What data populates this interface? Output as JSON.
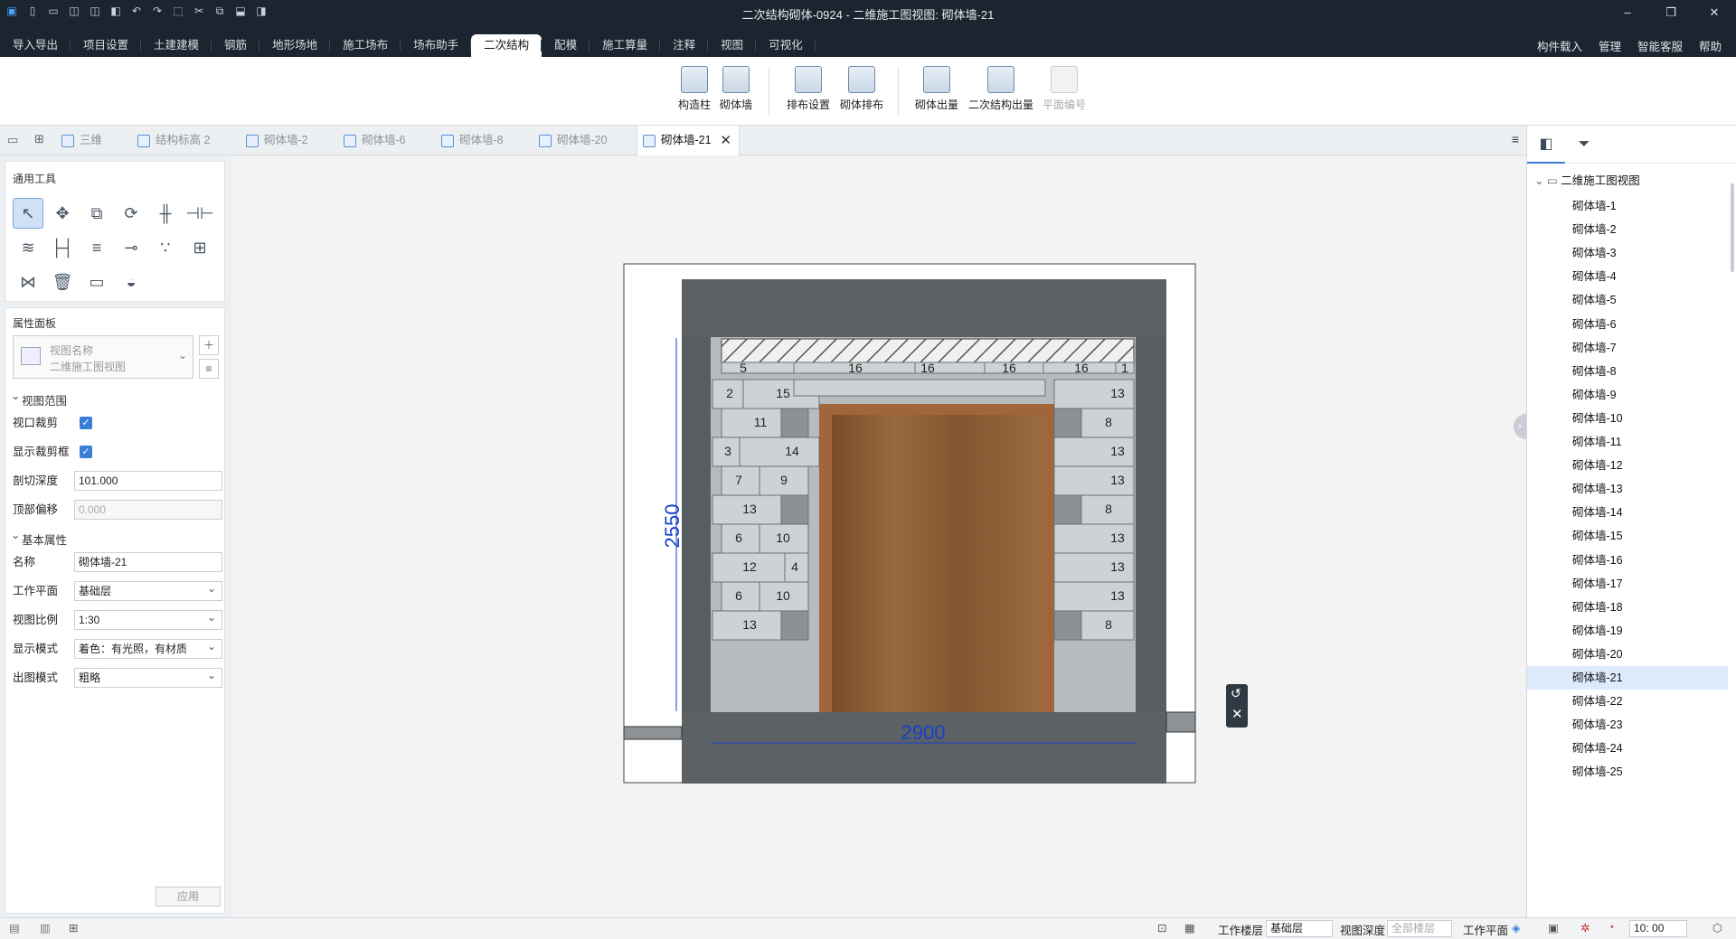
{
  "title": "二次结构砌体-0924 - 二维施工图视图: 砌体墙-21",
  "quick_access_icons": [
    "logo-icon",
    "new-icon",
    "open-icon",
    "save-icon",
    "save-as-icon",
    "export-icon",
    "undo-icon",
    "redo-icon",
    "select-icon",
    "cut-icon",
    "copy-icon",
    "paste-icon",
    "view-icon"
  ],
  "window": {
    "minimize": "–",
    "restore": "❐",
    "close": "✕"
  },
  "menu": {
    "tabs": [
      "导入导出",
      "项目设置",
      "土建建模",
      "钢筋",
      "地形场地",
      "施工场布",
      "场布助手",
      "二次结构",
      "配模",
      "施工算量",
      "注释",
      "视图",
      "可视化"
    ],
    "active": "二次结构",
    "right": [
      "构件载入",
      "管理",
      "智能客服",
      "帮助"
    ]
  },
  "ribbon": {
    "buttons": [
      "构造柱",
      "砌体墙",
      "排布设置",
      "砌体排布",
      "砌体出量",
      "二次结构出量",
      "平面编号"
    ],
    "disabled": [
      "平面编号"
    ]
  },
  "doc_tabs": {
    "items": [
      "三维",
      "结构标高 2",
      "砌体墙-2",
      "砌体墙-6",
      "砌体墙-8",
      "砌体墙-20",
      "砌体墙-21"
    ],
    "active": "砌体墙-21"
  },
  "tools_panel": {
    "title": "通用工具"
  },
  "properties": {
    "title": "属性面板",
    "view_name_label": "视图名称",
    "view_name_value": "二维施工图视图",
    "group_view_range": "视图范围",
    "viewport_crop_label": "视口裁剪",
    "viewport_crop": true,
    "show_crop_label": "显示裁剪框",
    "show_crop": true,
    "cut_depth_label": "剖切深度",
    "cut_depth": "101.000",
    "top_offset_label": "顶部偏移",
    "top_offset": "0.000",
    "group_basic": "基本属性",
    "name_label": "名称",
    "name": "砌体墙-21",
    "workplane_label": "工作平面",
    "workplane": "基础层",
    "scale_label": "视图比例",
    "scale": "1:30",
    "display_mode_label": "显示模式",
    "display_mode": "着色：有光照，有材质",
    "output_mode_label": "出图模式",
    "output_mode": "粗略",
    "apply": "应用"
  },
  "drawing": {
    "dim_height": "2550",
    "dim_width": "2900",
    "top_labels": [
      "5",
      "16",
      "16",
      "16",
      "16",
      "1"
    ],
    "left_blocks": [
      "2",
      "15",
      "11",
      "3",
      "14",
      "7",
      "9",
      "13",
      "6",
      "10",
      "12",
      "4",
      "6",
      "10",
      "13"
    ],
    "right_blocks": [
      "13",
      "8",
      "13",
      "13",
      "8",
      "13",
      "13",
      "13",
      "8"
    ]
  },
  "tree": {
    "root": "二维施工图视图",
    "items": [
      "砌体墙-1",
      "砌体墙-2",
      "砌体墙-3",
      "砌体墙-4",
      "砌体墙-5",
      "砌体墙-6",
      "砌体墙-7",
      "砌体墙-8",
      "砌体墙-9",
      "砌体墙-10",
      "砌体墙-11",
      "砌体墙-12",
      "砌体墙-13",
      "砌体墙-14",
      "砌体墙-15",
      "砌体墙-16",
      "砌体墙-17",
      "砌体墙-18",
      "砌体墙-19",
      "砌体墙-20",
      "砌体墙-21",
      "砌体墙-22",
      "砌体墙-23",
      "砌体墙-24",
      "砌体墙-25"
    ],
    "selected": "砌体墙-21"
  },
  "status": {
    "work_floor_label": "工作楼层",
    "work_floor": "基础层",
    "view_depth_label": "视图深度",
    "view_depth": "全部楼层",
    "work_plane_label": "工作平面",
    "time": "10: 00"
  },
  "colors": {
    "dark": "#1b2530",
    "accent": "#3b7ed6",
    "door": "#8a5a32",
    "dim": "#1740c9"
  }
}
